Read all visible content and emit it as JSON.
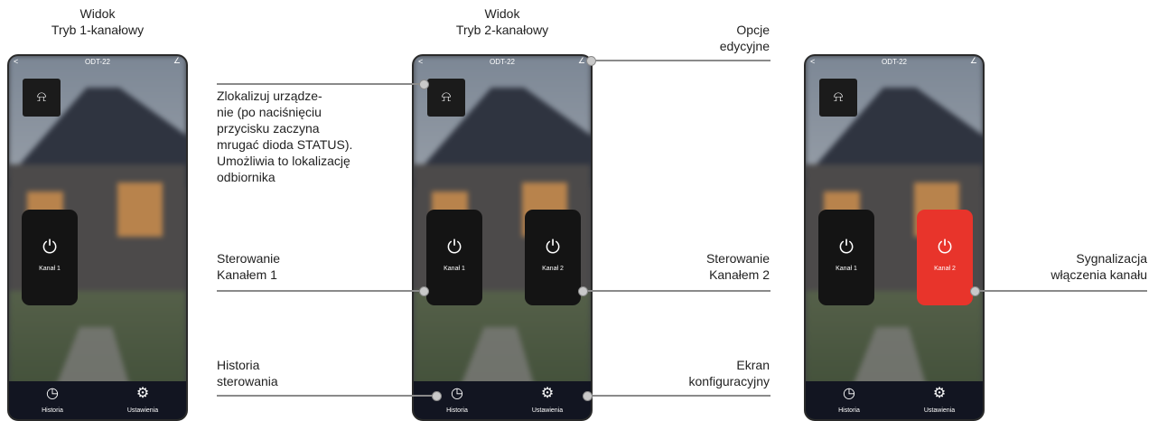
{
  "captions": {
    "left": [
      "Widok",
      "Tryb 1-kanałowy"
    ],
    "middle": [
      "Widok",
      "Tryb 2-kanałowy"
    ]
  },
  "phone": {
    "device_name": "ODT-22",
    "back_icon": "<",
    "edit_icon": "edit-pencil-icon",
    "locate_icon": "siren-icon",
    "power_icon": "power-icon",
    "channel1": "Kanał 1",
    "channel2": "Kanał 2",
    "history": "Historia",
    "settings": "Ustawienia",
    "accent_on": "#e8342b"
  },
  "annotations": {
    "edit_options": [
      "Opcje",
      "edycyjne"
    ],
    "locate": [
      "Zlokalizuj urządze-",
      "nie (po naciśnięciu",
      "przycisku zaczyna",
      "mrugać dioda STATUS).",
      "Umożliwia to lokalizację",
      "odbiornika"
    ],
    "ch1": [
      "Sterowanie",
      "Kanałem 1"
    ],
    "ch2": [
      "Sterowanie",
      "Kanałem 2"
    ],
    "history": [
      "Historia",
      "sterowania"
    ],
    "config": [
      "Ekran",
      "konfiguracyjny"
    ],
    "signal": [
      "Sygnalizacja",
      "włączenia kanału"
    ]
  }
}
